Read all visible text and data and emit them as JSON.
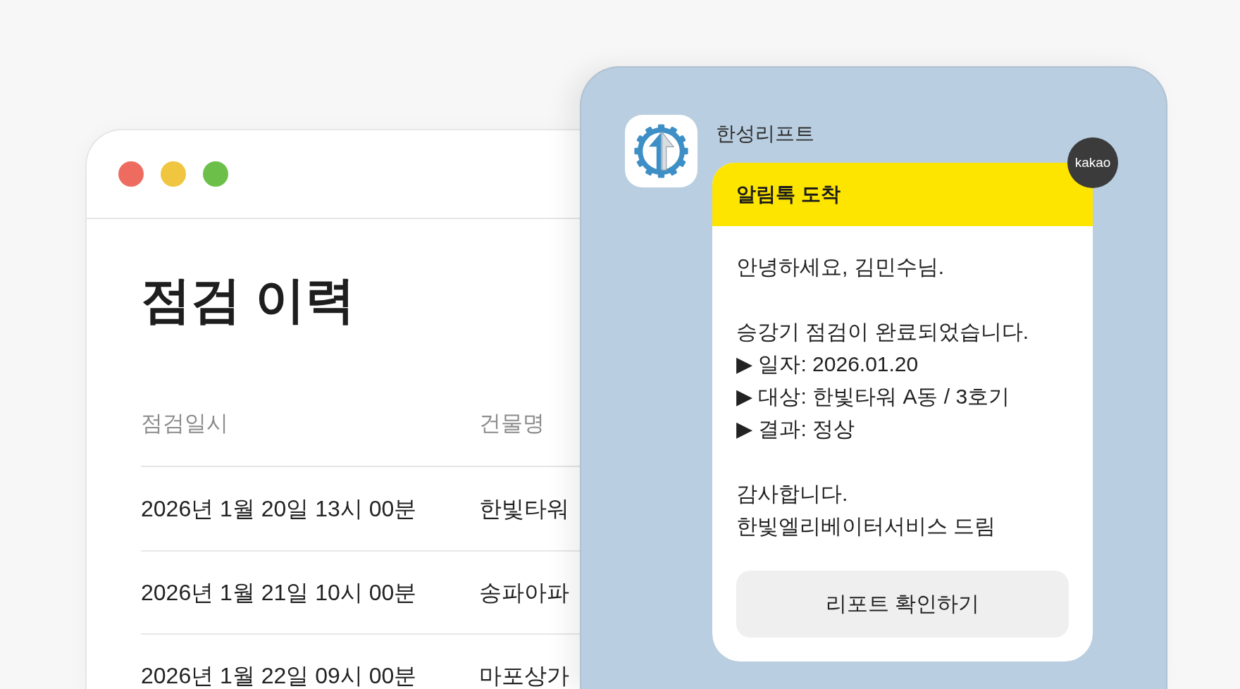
{
  "desktop_window": {
    "traffic_lights": [
      {
        "color": "#ee6b60"
      },
      {
        "color": "#f0c640"
      },
      {
        "color": "#6cc04a"
      }
    ],
    "title": "점검 이력",
    "table": {
      "columns": [
        "점검일시",
        "건물명"
      ],
      "rows": [
        [
          "2026년 1월 20일 13시 00분",
          "한빛타워"
        ],
        [
          "2026년 1월 21일 10시 00분",
          "송파아파"
        ],
        [
          "2026년 1월 22일 09시 00분",
          "마포상가"
        ]
      ]
    }
  },
  "chat": {
    "sender": "한성리프트",
    "message": {
      "header": "알림톡 도착",
      "badge": "kakao",
      "paragraphs": [
        [
          "안녕하세요, 김민수님."
        ],
        [
          "승강기 점검이 완료되었습니다.",
          "▶ 일자: 2026.01.20",
          "▶ 대상: 한빛타워 A동 / 3호기",
          "▶ 결과: 정상"
        ],
        [
          "감사합니다.",
          "한빛엘리베이터서비스 드림"
        ]
      ],
      "button": "리포트 확인하기"
    }
  }
}
